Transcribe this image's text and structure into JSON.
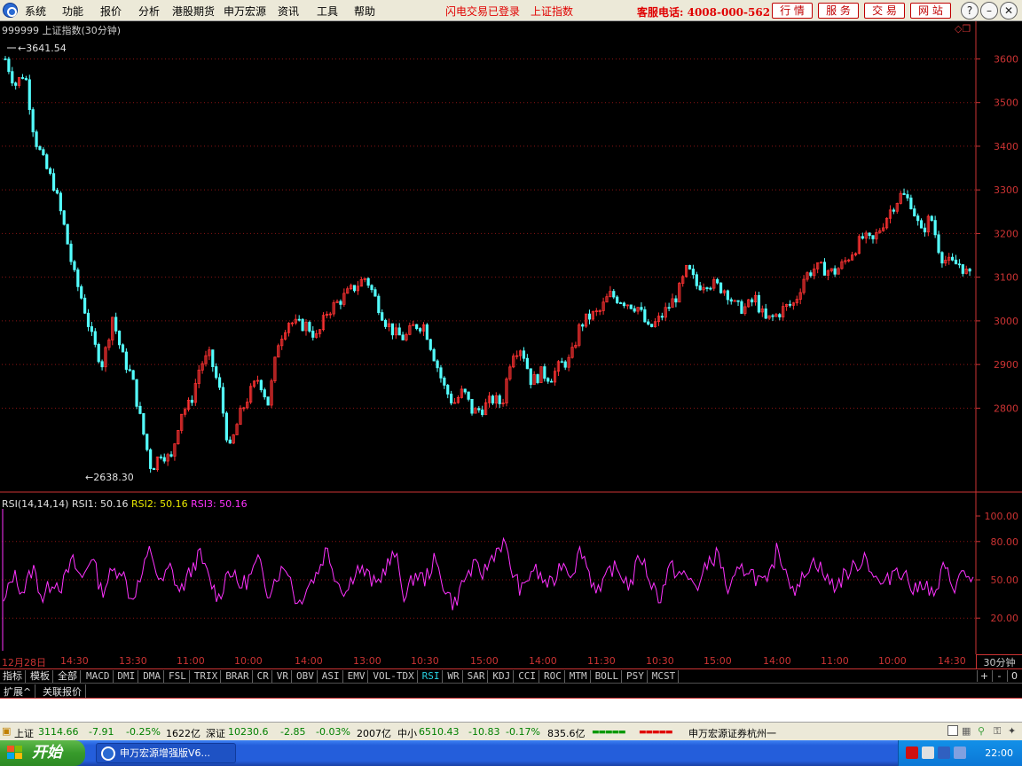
{
  "menu": {
    "items": [
      "系统",
      "功能",
      "报价",
      "分析",
      "港股期货",
      "申万宏源",
      "资讯",
      "工具",
      "帮助"
    ],
    "status_login": "闪电交易已登录",
    "status_index": "上证指数",
    "hotline": "客服电话: 4008-000-562",
    "nav_buttons": [
      "行 情",
      "服 务",
      "交 易",
      "网 站"
    ],
    "window_buttons": [
      "?",
      "–",
      "❐",
      "✕"
    ]
  },
  "chart_header": {
    "code": "999999",
    "name": "上证指数",
    "period": "(30分钟)",
    "high_label": "3641.54",
    "low_label": "2638.30"
  },
  "indicator_header": {
    "name": "RSI(14,14,14)",
    "rsi1_label": "RSI1:",
    "rsi1_value": "50.16",
    "rsi2_label": "RSI2:",
    "rsi2_value": "50.16",
    "rsi3_label": "RSI3:",
    "rsi3_value": "50.16"
  },
  "colors": {
    "up": "#ff3232",
    "down": "#54ffff",
    "rsi": "#ff32ff",
    "axis": "#cc3333",
    "grid": "#8c1414"
  },
  "chart_data": [
    {
      "type": "candlestick",
      "title": "999999 上证指数(30分钟)",
      "y_axis_ticks": [
        2800,
        2900,
        3000,
        3100,
        3200,
        3300,
        3400,
        3500,
        3600
      ],
      "ylim": [
        2638.3,
        3641.54
      ],
      "max_marker": 3641.54,
      "min_marker": 2638.3,
      "grid": true,
      "series": [
        {
          "name": "close",
          "values": [
            3600,
            3540,
            3570,
            3420,
            3360,
            3310,
            3220,
            3110,
            3040,
            2950,
            2900,
            3010,
            2920,
            2870,
            2760,
            2660,
            2700,
            2680,
            2790,
            2810,
            2900,
            2920,
            2840,
            2700,
            2780,
            2830,
            2870,
            2810,
            2950,
            3000,
            2990,
            2990,
            2960,
            3020,
            3040,
            3060,
            3080,
            3100,
            3050,
            3000,
            2970,
            2960,
            2990,
            2990,
            2920,
            2850,
            2810,
            2840,
            2790,
            2800,
            2820,
            2810,
            2930,
            2940,
            2860,
            2880,
            2870,
            2900,
            2910,
            2990,
            3010,
            3020,
            3060,
            3050,
            3040,
            3030,
            2980,
            3000,
            3030,
            3060,
            3120,
            3080,
            3090,
            3080,
            3070,
            3030,
            3030,
            3050,
            3000,
            3010,
            3030,
            3040,
            3100,
            3120,
            3120,
            3110,
            3130,
            3160,
            3190,
            3180,
            3220,
            3260,
            3290,
            3270,
            3200,
            3240,
            3150,
            3130,
            3130,
            3100
          ]
        },
        {
          "name": "RSI",
          "values": [
            30,
            55,
            40,
            60,
            35,
            50,
            45,
            65,
            50,
            70,
            40,
            55,
            60,
            35,
            50,
            75,
            45,
            60,
            40,
            55,
            70,
            50,
            35,
            60,
            45,
            50,
            65,
            40,
            55,
            60,
            30,
            45,
            55,
            75,
            50,
            40,
            60,
            55,
            45,
            60,
            70,
            35,
            55,
            50,
            65,
            45,
            30,
            50,
            60,
            55,
            70,
            80,
            55,
            40,
            60,
            50,
            45,
            65,
            55,
            75,
            50,
            40,
            60,
            55,
            45,
            70,
            50,
            35,
            60,
            55,
            50,
            45,
            65,
            70,
            40,
            55,
            60,
            50,
            45,
            75,
            55,
            40,
            60,
            65,
            50,
            45,
            55,
            60,
            70,
            50,
            45,
            60,
            55,
            40,
            50,
            35,
            60,
            45,
            55,
            50
          ]
        }
      ]
    },
    {
      "type": "line",
      "title": "RSI(14,14,14)",
      "y_axis_ticks": [
        20,
        50,
        80,
        100
      ],
      "ylim": [
        0,
        100
      ],
      "grid": true
    }
  ],
  "time_axis": [
    "12月28日",
    "14:30",
    "13:30",
    "11:00",
    "10:00",
    "14:00",
    "13:00",
    "10:30",
    "15:00",
    "14:00",
    "11:30",
    "10:30",
    "15:00",
    "14:00",
    "11:00",
    "10:00",
    "14:30"
  ],
  "period_label": "30分钟",
  "tabs_left": [
    "指标",
    "模板",
    "全部"
  ],
  "indicator_tabs": [
    "MACD",
    "DMI",
    "DMA",
    "FSL",
    "TRIX",
    "BRAR",
    "CR",
    "VR",
    "OBV",
    "ASI",
    "EMV",
    "VOL-TDX",
    "RSI",
    "WR",
    "SAR",
    "KDJ",
    "CCI",
    "ROC",
    "MTM",
    "BOLL",
    "PSY",
    "MCST"
  ],
  "active_tab": "RSI",
  "tab_controls": [
    "+",
    "-",
    "0"
  ],
  "ext_tabs": [
    "扩展^",
    "关联报价"
  ],
  "status": {
    "sh_label": "上证",
    "sh_value": "3114.66",
    "sh_change": "-7.91",
    "sh_pct": "-0.25%",
    "sh_amount": "1622亿",
    "sz_label": "深证",
    "sz_value": "10230.6",
    "sz_change": "-2.85",
    "sz_pct": "-0.03%",
    "sz_amount": "2007亿",
    "zx_label": "中小",
    "zx_value": "6510.43",
    "zx_change": "-10.83",
    "zx_pct": "-0.17%",
    "zx_amount": "835.6亿",
    "branch": "申万宏源证券杭州一"
  },
  "taskbar": {
    "start_label": "开始",
    "task_label": "申万宏源增强版V6...",
    "clock": "22:00"
  }
}
